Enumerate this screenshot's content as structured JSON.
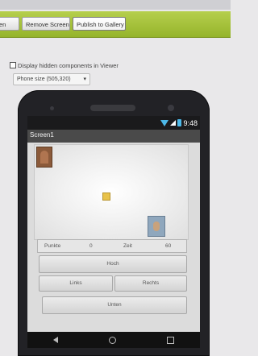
{
  "toolbar": {
    "partial_button": "en",
    "remove_screen": "Remove Screen",
    "publish": "Publish to Gallery"
  },
  "options": {
    "hidden_components_label": "Display hidden components in Viewer",
    "phone_size": "Phone size (505,320)"
  },
  "phone": {
    "clock": "9:48",
    "screen_title": "Screen1",
    "info": {
      "punkte_label": "Punkte",
      "punkte_value": "0",
      "zeit_label": "Zeit",
      "zeit_value": "60"
    },
    "buttons": {
      "up": "Hoch",
      "left": "Links",
      "right": "Rechts",
      "down": "Unten"
    }
  }
}
